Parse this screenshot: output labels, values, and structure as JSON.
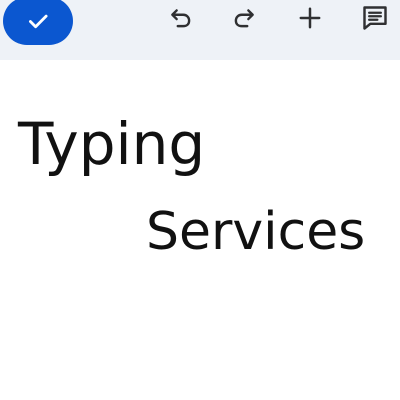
{
  "toolbar": {
    "done_icon": "check-icon",
    "undo_icon": "undo-icon",
    "redo_icon": "redo-icon",
    "insert_icon": "plus-icon",
    "comment_icon": "comment-icon",
    "accent_color": "#0b57d0",
    "background_color": "#eef2f7"
  },
  "document": {
    "lines": [
      "Typing",
      "Services"
    ]
  }
}
